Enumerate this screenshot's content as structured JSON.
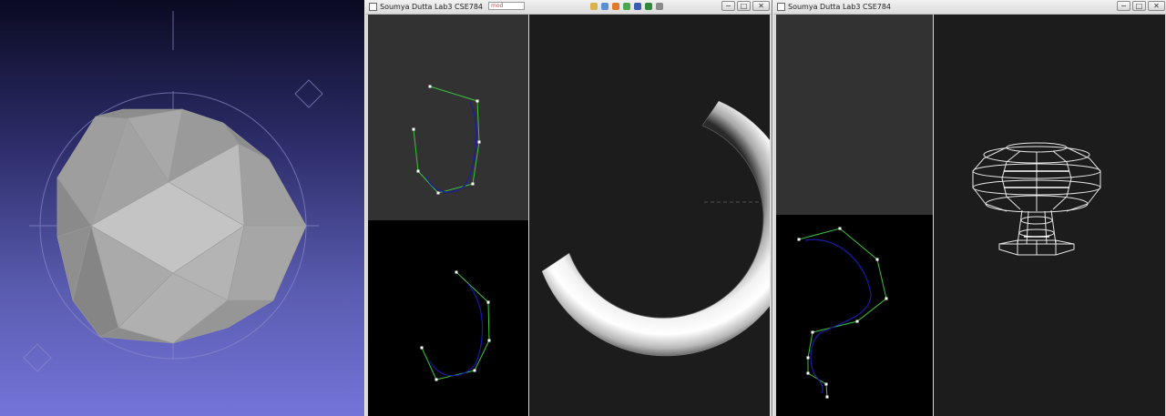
{
  "viewer": {
    "gizmo": "trackball-gizmo",
    "model": "polyhedron-model"
  },
  "window_a": {
    "title": "Soumya Dutta Lab3 CSE784",
    "search_text": "mod",
    "buttons": {
      "minimize": "−",
      "maximize": "□",
      "close": "✕"
    },
    "views": [
      "top-curve-editor",
      "bottom-curve-editor",
      "render-view"
    ]
  },
  "window_b": {
    "title": "Soumya Dutta Lab3 CSE784",
    "buttons": {
      "minimize": "−",
      "maximize": "□",
      "close": "✕"
    },
    "views": [
      "top-empty-view",
      "bottom-curve-editor",
      "wireframe-view"
    ]
  },
  "colors": {
    "control_polygon": "#3ec43e",
    "curve": "#1a1aa8",
    "control_point": "#ffffff",
    "editor_top_bg": "#323232",
    "editor_bottom_bg": "#000000",
    "render_bg": "#1c1c1c"
  }
}
